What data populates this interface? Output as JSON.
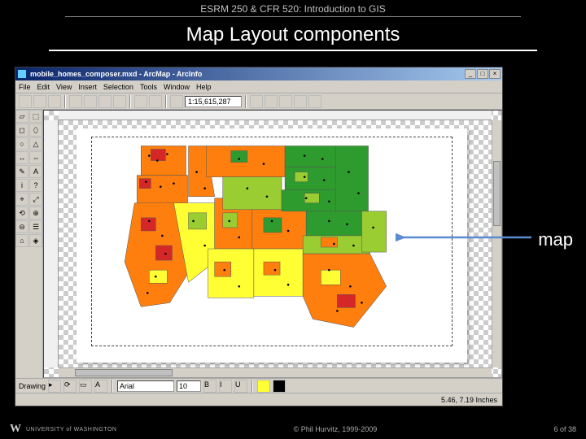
{
  "header": {
    "course": "ESRM 250 & CFR 520: Introduction to GIS",
    "title": "Map Layout components"
  },
  "app": {
    "title": "mobile_homes_composer.mxd - ArcMap - ArcInfo",
    "menus": [
      "File",
      "Edit",
      "View",
      "Insert",
      "Selection",
      "Tools",
      "Window",
      "Help"
    ],
    "scale": "1:15,615,287",
    "window_buttons": {
      "min": "_",
      "max": "□",
      "close": "×"
    }
  },
  "palette": {
    "tools": [
      "▱",
      "⬚",
      "◻",
      "⬯",
      "○",
      "△",
      "↔",
      "⇔",
      "✎",
      "A",
      "i",
      "?",
      "⌖",
      "⤢",
      "⟲",
      "⊕",
      "⊖",
      "☰",
      "⌂",
      "◈"
    ]
  },
  "draw_toolbar": {
    "label": "Drawing",
    "font": "Arial",
    "size": "10",
    "style_buttons": [
      "B",
      "I",
      "U"
    ]
  },
  "statusbar": {
    "coords": "5.46, 7.19 Inches"
  },
  "callout": {
    "label": "map"
  },
  "footer": {
    "logo_text": "UNIVERSITY of WASHINGTON",
    "copyright": "© Phil Hurvitz, 1999-2009",
    "page": "6 of 38"
  },
  "map": {
    "colors": {
      "low": "#2e9b2e",
      "mid1": "#9acd32",
      "mid2": "#ffff33",
      "high1": "#ff7f0e",
      "high2": "#d62728"
    },
    "description": "Choropleth of western US counties, dots for city points"
  }
}
